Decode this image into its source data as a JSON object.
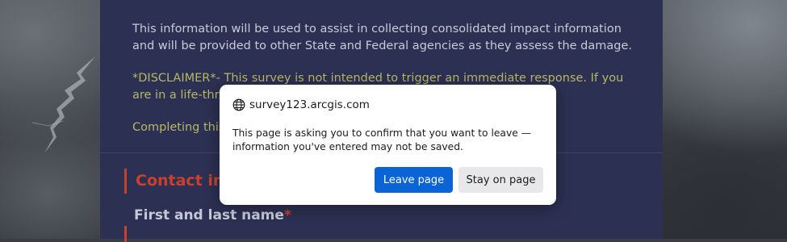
{
  "survey": {
    "fragment": "...",
    "paragraph1": "This information will be used to assist in collecting consolidated impact information and will be provided to other State and Federal agencies as they assess the damage.",
    "paragraph2": "*DISCLAIMER*- This survey is not intended to trigger an immediate response. If you are in a life-threatening s",
    "paragraph3": "Completing this",
    "section_title": "Contact inf",
    "field_label": "First and last name",
    "required_mark": "*"
  },
  "dialog": {
    "host": "survey123.arcgis.com",
    "host_icon": "globe-icon",
    "message": "This page is asking you to confirm that you want to leave — information you've entered may not be saved.",
    "leave_label": "Leave page",
    "stay_label": "Stay on page"
  },
  "colors": {
    "panel": "#2c3052",
    "accent_red": "#c9412d",
    "disclaimer_text": "#b7b768",
    "primary_button": "#0a64d6"
  }
}
